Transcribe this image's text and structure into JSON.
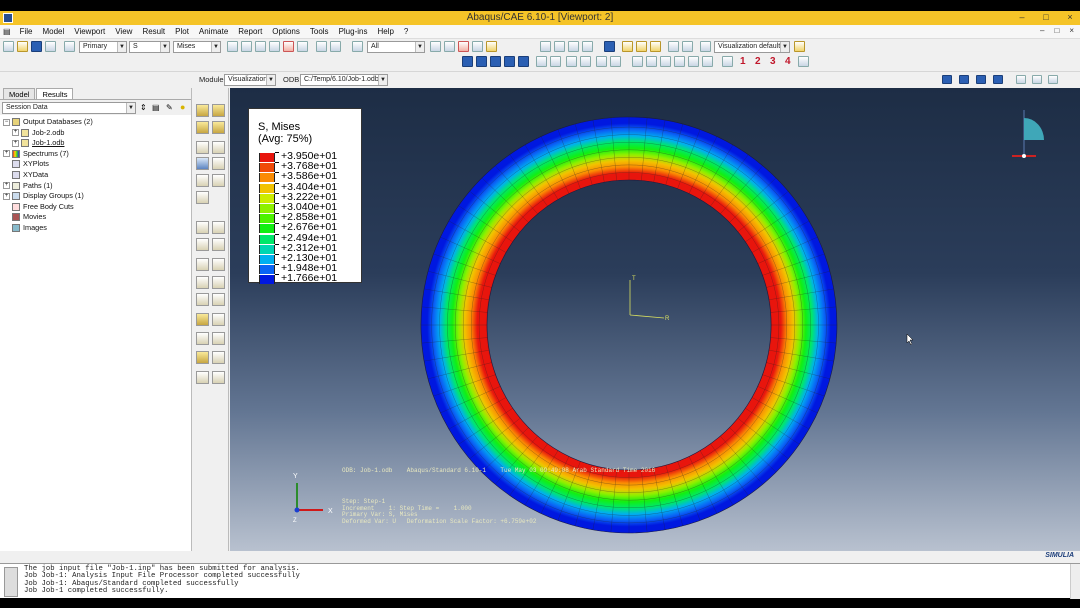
{
  "window": {
    "title": "Abaqus/CAE 6.10-1 [Viewport: 2]",
    "controls": [
      "–",
      "□",
      "×"
    ]
  },
  "menu": {
    "items": [
      "File",
      "Model",
      "Viewport",
      "View",
      "Result",
      "Plot",
      "Animate",
      "Report",
      "Options",
      "Tools",
      "Plug-ins",
      "Help",
      "?"
    ]
  },
  "toolbar": {
    "step_type": "Primary",
    "variable": "S",
    "invariant": "Mises",
    "select_filter": "All",
    "view_defaults": "Visualization defaults",
    "step_numbers": [
      "1",
      "2",
      "3",
      "4"
    ]
  },
  "context": {
    "module_label": "Module:",
    "module_value": "Visualization",
    "odb_label": "ODB:",
    "odb_value": "C:/Temp/6.10/Job-1.odb"
  },
  "left_panel": {
    "tabs": [
      "Model",
      "Results"
    ],
    "active_tab": "Results",
    "session_select": "Session Data",
    "tree": [
      {
        "label": "Output Databases (2)",
        "level": 0,
        "expand": "−"
      },
      {
        "label": "Job-2.odb",
        "level": 1,
        "expand": "+"
      },
      {
        "label": "Job-1.odb",
        "level": 1,
        "expand": "+"
      },
      {
        "label": "Spectrums (7)",
        "level": 0,
        "expand": "+"
      },
      {
        "label": "XYPlots",
        "level": 0,
        "expand": ""
      },
      {
        "label": "XYData",
        "level": 0,
        "expand": ""
      },
      {
        "label": "Paths (1)",
        "level": 0,
        "expand": "+"
      },
      {
        "label": "Display Groups (1)",
        "level": 0,
        "expand": "+"
      },
      {
        "label": "Free Body Cuts",
        "level": 0,
        "expand": ""
      },
      {
        "label": "Movies",
        "level": 0,
        "expand": ""
      },
      {
        "label": "Images",
        "level": 0,
        "expand": ""
      }
    ]
  },
  "legend": {
    "title1": "S, Mises",
    "title2": "(Avg: 75%)",
    "values": [
      "+3.950e+01",
      "+3.768e+01",
      "+3.586e+01",
      "+3.404e+01",
      "+3.222e+01",
      "+3.040e+01",
      "+2.858e+01",
      "+2.676e+01",
      "+2.494e+01",
      "+2.312e+01",
      "+2.130e+01",
      "+1.948e+01",
      "+1.766e+01"
    ],
    "colors": [
      "#e8150d",
      "#f04a08",
      "#fb8b03",
      "#f2c200",
      "#ccec00",
      "#8df000",
      "#4cf200",
      "#12ef12",
      "#00e86a",
      "#00d6b2",
      "#00b0f0",
      "#0a64f5",
      "#0018e0"
    ]
  },
  "viewport_info": {
    "line1": "ODB: Job-1.odb    Abaqus/Standard 6.10-1    Tue May 03 09:49:08 Arab Standard Time 2016",
    "line2": "Step: Step-1\nIncrement    1: Step Time =    1.000\nPrimary Var: S, Mises\nDeformed Var: U   Deformation Scale Factor: +6.759e+02",
    "triad_x": "X",
    "triad_y": "Y",
    "triad_z": "Z",
    "local_t": "T",
    "local_r": "R"
  },
  "messages": {
    "text": "The job input file \"Job-1.inp\" has been submitted for analysis.\nJob Job-1: Analysis Input File Processor completed successfully\nJob Job-1: Abaqus/Standard completed successfully\nJob Job-1 completed successfully."
  },
  "brand": "SIMULIA"
}
